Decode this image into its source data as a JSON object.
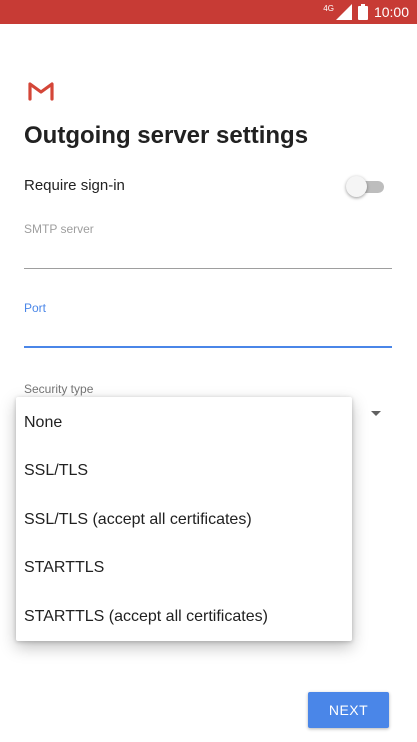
{
  "status_bar": {
    "network": "4G",
    "time": "10:00",
    "icons": [
      "signal-icon",
      "battery-icon"
    ]
  },
  "app": {
    "logo": "gmail-logo-icon"
  },
  "header": {
    "title": "Outgoing server settings"
  },
  "require_signin": {
    "label": "Require sign-in",
    "enabled": false
  },
  "smtp_server": {
    "label": "SMTP server",
    "value": ""
  },
  "port": {
    "label": "Port",
    "value": ""
  },
  "security_type": {
    "label": "Security type",
    "options": [
      "None",
      "SSL/TLS",
      "SSL/TLS (accept all certificates)",
      "STARTTLS",
      "STARTTLS (accept all certificates)"
    ]
  },
  "footer": {
    "next_label": "NEXT"
  },
  "colors": {
    "status_bar": "#c73b35",
    "accent": "#4a86e8",
    "gmail_red": "#d44638"
  }
}
